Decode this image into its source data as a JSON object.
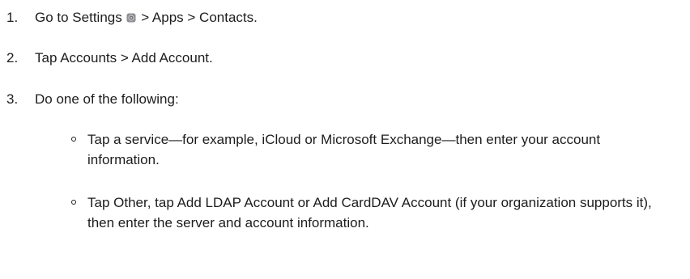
{
  "steps": [
    {
      "number": "1.",
      "text_before_icon": "Go to Settings",
      "icon": "settings-gear-icon",
      "text_after_icon": "> Apps > Contacts."
    },
    {
      "number": "2.",
      "text": "Tap Accounts > Add Account."
    },
    {
      "number": "3.",
      "text": "Do one of the following:"
    }
  ],
  "substeps": [
    {
      "text": "Tap a service—for example, iCloud or Microsoft Exchange—then enter your account information."
    },
    {
      "text": "Tap Other, tap Add LDAP Account or Add CardDAV Account (if your organization supports it), then enter the server and account information."
    }
  ],
  "colors": {
    "text": "#1d1d1f",
    "background": "#ffffff",
    "icon_gray": "#8e8e93"
  }
}
